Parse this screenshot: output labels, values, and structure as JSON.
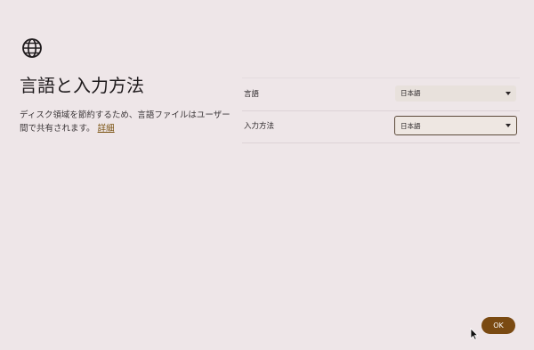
{
  "page": {
    "title": "言語と入力方法",
    "description": "ディスク領域を節約するため、言語ファイルはユーザー間で共有されます。",
    "description_link": "詳細"
  },
  "settings": [
    {
      "label": "言語",
      "value": "日本語"
    },
    {
      "label": "入力方法",
      "value": "日本語"
    }
  ],
  "footer": {
    "ok_label": "OK"
  },
  "colors": {
    "background": "#eee6e8",
    "accent": "#7a4a12",
    "link": "#7a5210"
  },
  "icons": {
    "header": "globe-icon",
    "dropdown": "chevron-down-icon",
    "pointer": "mouse-cursor-icon"
  }
}
